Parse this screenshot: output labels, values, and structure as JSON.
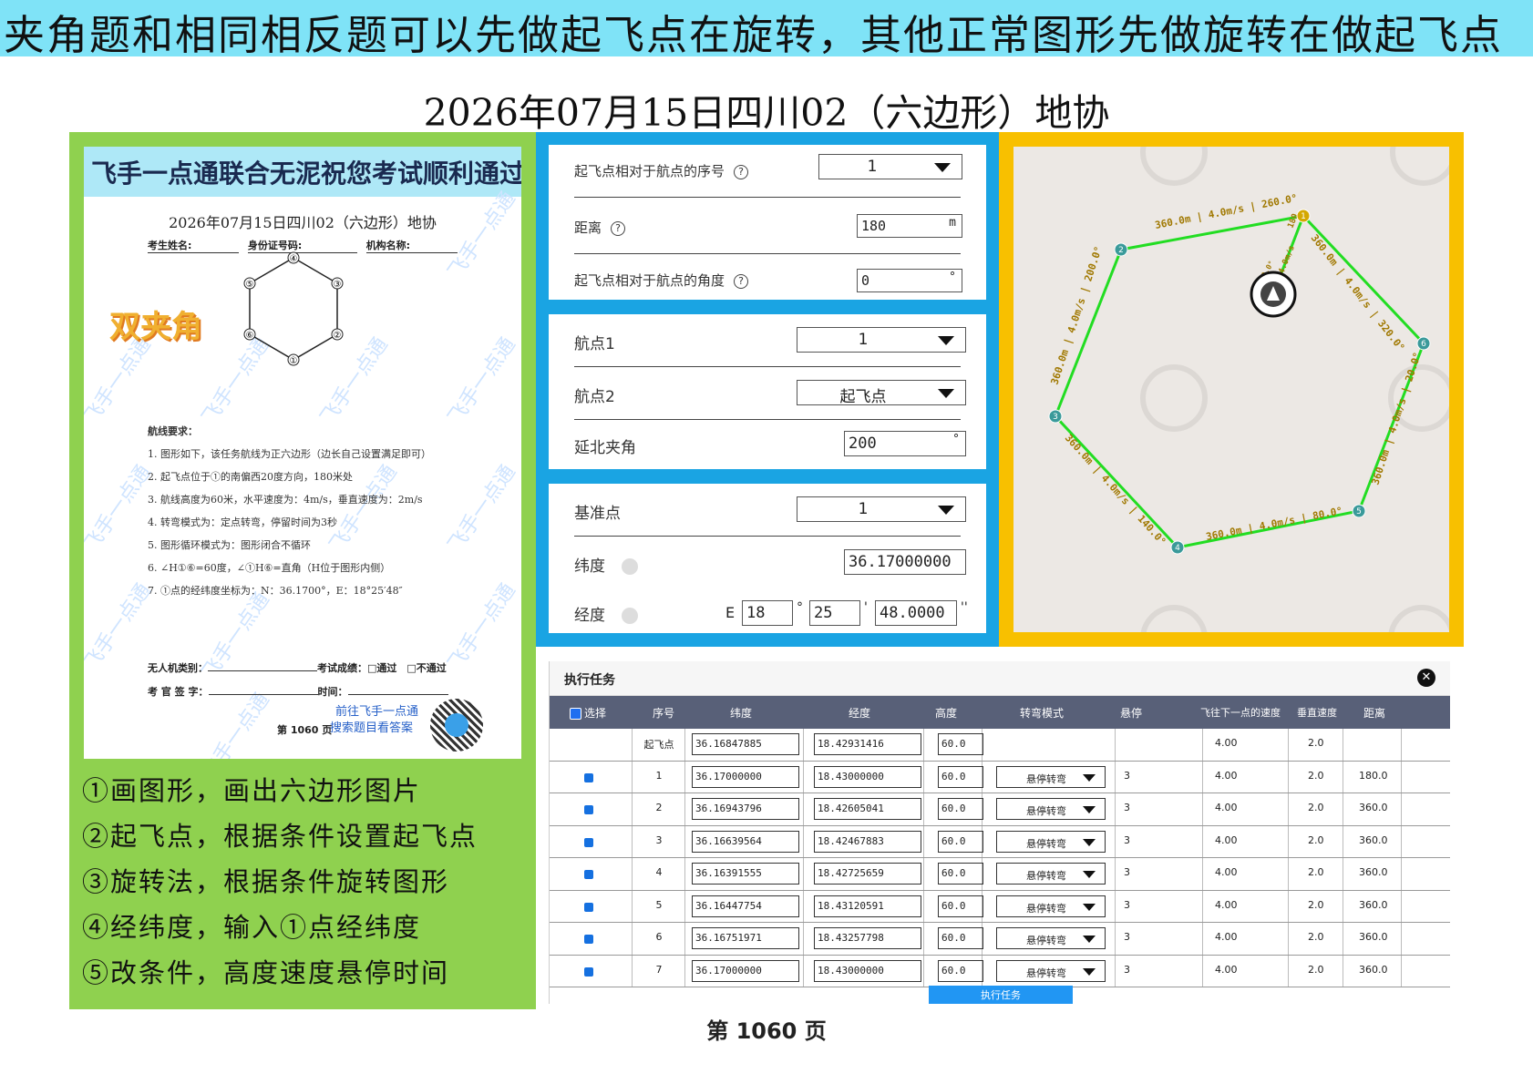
{
  "banner": "夹角题和相同相反题可以先做起飞点在旋转，其他正常图形先做旋转在做起飞点",
  "title": "2026年07月15日四川02（六边形）地协",
  "paper": {
    "header": "飞手一点通联合无泥祝您考试顺利通过",
    "title": "2026年07月15日四川02（六边形）地协",
    "field_name": "考生姓名:",
    "field_id": "身份证号码:",
    "field_org": "机构名称:",
    "badge": "双夹角",
    "watermark": "飞手一点通",
    "hex_labels": [
      "①",
      "②",
      "③",
      "④",
      "⑤",
      "⑥"
    ],
    "req_title": "航线要求：",
    "requirements": [
      "1. 图形如下，该任务航线为正六边形（边长自己设置满足即可）",
      "2. 起飞点位于①的南偏西20度方向，180米处",
      "3. 航线高度为60米，水平速度为：4m/s，垂直速度为：2m/s",
      "4. 转弯模式为：定点转弯，停留时间为3秒",
      "5. 图形循环模式为：图形闭合不循环",
      "6. ∠H①⑥=60度，∠①H⑥=直角（H位于图形内侧）",
      "7. ①点的经纬度坐标为：N：36.1700°，E：18°25′48″"
    ],
    "footer_line1_a": "无人机类别：",
    "footer_line1_b": "考试成绩：□通过　□不通过",
    "footer_line2_a": "考 官 签 字：",
    "footer_line2_b": "时间：",
    "goto_line1": "前往飞手一点通",
    "goto_line2": "搜索题目看答案",
    "page": "第 1060 页"
  },
  "steps": [
    "①画图形，画出六边形图片",
    "②起飞点，根据条件设置起飞点",
    "③旋转法，根据条件旋转图形",
    "④经纬度，输入①点经纬度",
    "⑤改条件，高度速度悬停时间"
  ],
  "form1": {
    "seq_label": "起飞点相对于航点的序号",
    "seq_value": "1",
    "dist_label": "距离",
    "dist_value": "180",
    "dist_unit": "m",
    "angle_label": "起飞点相对于航点的角度",
    "angle_value": "0",
    "angle_unit": "°",
    "help": "?"
  },
  "form2": {
    "wp1_label": "航点1",
    "wp1_value": "1",
    "wp2_label": "航点2",
    "wp2_value": "起飞点",
    "angle_label": "延北夹角",
    "angle_value": "200",
    "angle_unit": "°"
  },
  "form3": {
    "base_label": "基准点",
    "base_value": "1",
    "lat_label": "纬度",
    "lat_value": "36.17000000",
    "lon_label": "经度",
    "lon_prefix": "E",
    "lon_deg": "18",
    "lon_min": "25",
    "lon_sec": "48.0000",
    "deg_sym": "°",
    "min_sym": "'",
    "sec_sym": "''"
  },
  "map": {
    "waypoints": [
      "1",
      "2",
      "3",
      "4",
      "5",
      "6"
    ],
    "edge_labels": [
      "360.0m | 4.0m/s | 260.0°",
      "360.0m | 4.0m/s | 320.0°",
      "360.0m | 4.0m/s | 20.0°",
      "360.0m | 4.0m/s | 80.0°",
      "360.0m | 4.0m/s | 140.0°",
      "360.0m | 4.0m/s | 200.0°"
    ],
    "home_labels": [
      "180",
      "4.0m/s",
      "20.0°"
    ]
  },
  "task": {
    "title": "执行任务",
    "close": "✕",
    "columns": [
      "选择",
      "序号",
      "纬度",
      "经度",
      "高度",
      "转弯模式",
      "悬停",
      "飞往下一点的速度",
      "垂直速度",
      "距离"
    ],
    "takeoff": {
      "seq": "起飞点",
      "lat": "36.16847885",
      "lon": "18.42931416",
      "alt": "60.0",
      "speed": "4.00",
      "vspeed": "2.0"
    },
    "rows": [
      {
        "seq": "1",
        "lat": "36.17000000",
        "lon": "18.43000000",
        "alt": "60.0",
        "mode": "悬停转弯",
        "hover": "3",
        "speed": "4.00",
        "vspeed": "2.0",
        "dist": "180.0"
      },
      {
        "seq": "2",
        "lat": "36.16943796",
        "lon": "18.42605041",
        "alt": "60.0",
        "mode": "悬停转弯",
        "hover": "3",
        "speed": "4.00",
        "vspeed": "2.0",
        "dist": "360.0"
      },
      {
        "seq": "3",
        "lat": "36.16639564",
        "lon": "18.42467883",
        "alt": "60.0",
        "mode": "悬停转弯",
        "hover": "3",
        "speed": "4.00",
        "vspeed": "2.0",
        "dist": "360.0"
      },
      {
        "seq": "4",
        "lat": "36.16391555",
        "lon": "18.42725659",
        "alt": "60.0",
        "mode": "悬停转弯",
        "hover": "3",
        "speed": "4.00",
        "vspeed": "2.0",
        "dist": "360.0"
      },
      {
        "seq": "5",
        "lat": "36.16447754",
        "lon": "18.43120591",
        "alt": "60.0",
        "mode": "悬停转弯",
        "hover": "3",
        "speed": "4.00",
        "vspeed": "2.0",
        "dist": "360.0"
      },
      {
        "seq": "6",
        "lat": "36.16751971",
        "lon": "18.43257798",
        "alt": "60.0",
        "mode": "悬停转弯",
        "hover": "3",
        "speed": "4.00",
        "vspeed": "2.0",
        "dist": "360.0"
      },
      {
        "seq": "7",
        "lat": "36.17000000",
        "lon": "18.43000000",
        "alt": "60.0",
        "mode": "悬停转弯",
        "hover": "3",
        "speed": "4.00",
        "vspeed": "2.0",
        "dist": "360.0"
      }
    ],
    "exec_label": "执行任务"
  },
  "footer": "第 1060 页",
  "colors": {
    "banner": "#7fe3f7",
    "green": "#8fd14f",
    "blue": "#1aa4e3",
    "orange": "#f8c000",
    "route": "#22dd22",
    "waypoint": "#3a9a9a",
    "header": "#586078"
  }
}
